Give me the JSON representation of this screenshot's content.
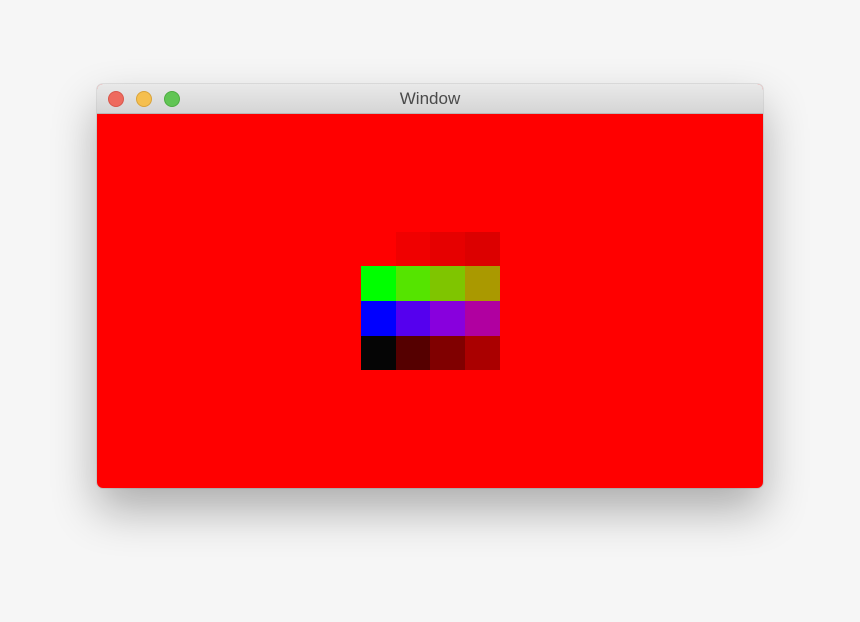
{
  "window": {
    "title": "Window",
    "background_color": "#ff0000"
  },
  "title_buttons": [
    {
      "name": "close-button",
      "color": "#ee6a5e"
    },
    {
      "name": "minimize-button",
      "color": "#f5bf4f"
    },
    {
      "name": "zoom-button",
      "color": "#61c554"
    }
  ],
  "swatch_grid": {
    "rows": 4,
    "columns": 4,
    "colors": [
      [
        "#ff0000",
        "#f00000",
        "#e60000",
        "#dc0000"
      ],
      [
        "#00ff00",
        "#55e400",
        "#7fc500",
        "#aa9900"
      ],
      [
        "#0000ff",
        "#5500ee",
        "#8800dd",
        "#b000a0"
      ],
      [
        "#050505",
        "#550000",
        "#800000",
        "#aa0000"
      ]
    ]
  }
}
